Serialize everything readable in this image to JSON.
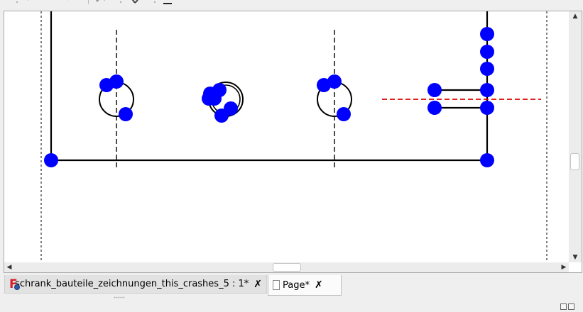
{
  "toolbar": {
    "icons": [
      "redo-icon",
      "refresh-icon",
      "selection-tool-icon",
      "menu-icon"
    ]
  },
  "drawing": {
    "colors": {
      "outline": "#000000",
      "handle": "#0000ff",
      "centerline": "#000000",
      "section_line": "#dd0000"
    }
  },
  "tabs": [
    {
      "label": "schrank_bauteile_zeichnungen_this_crashes_5 : 1*",
      "icon": "freecad-document-icon",
      "active": false
    },
    {
      "label": "Page*",
      "icon": "page-icon",
      "active": true
    }
  ],
  "tab_close_glyph": "✗",
  "scroll": {
    "up": "▲",
    "down": "▼",
    "left": "◀",
    "right": "▶"
  }
}
